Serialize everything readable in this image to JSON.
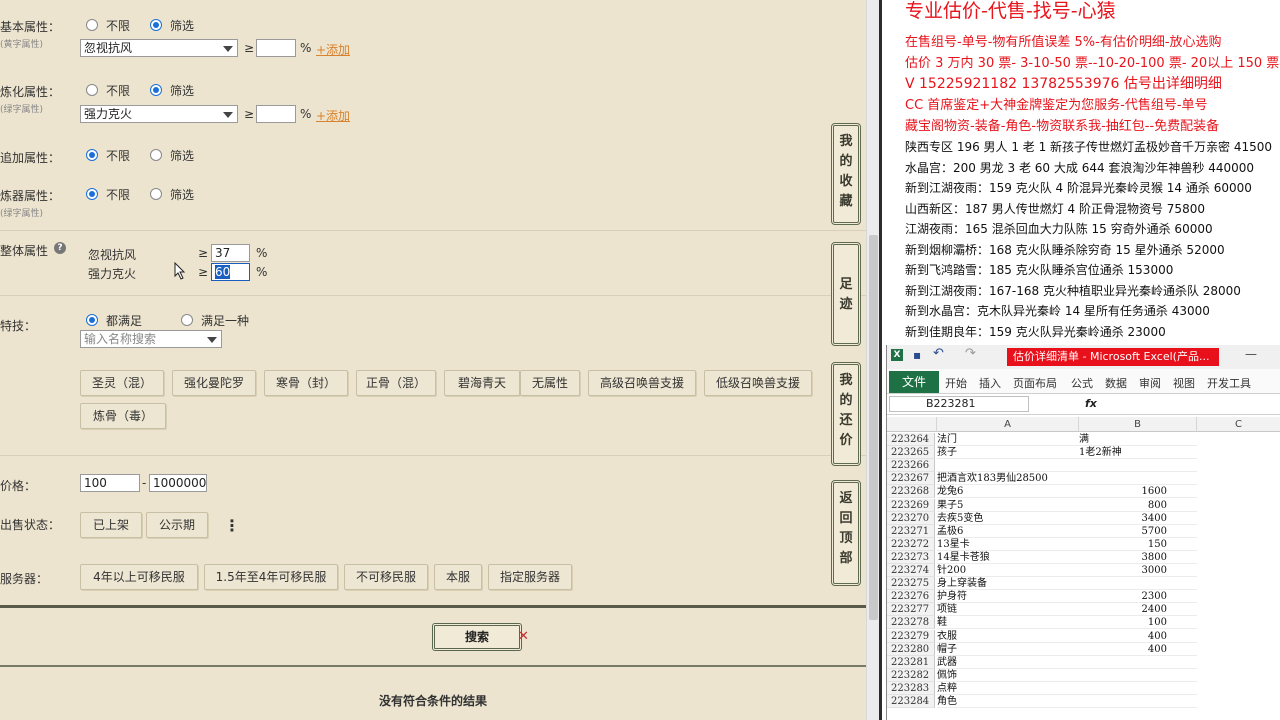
{
  "filters": {
    "basic": {
      "label": "基本属性：",
      "sub": "(黄字属性)",
      "opt1": "不限",
      "opt2": "筛选",
      "select": "忽视抗风",
      "ge": "≥",
      "pct": "%",
      "add": "+添加"
    },
    "refine": {
      "label": "炼化属性：",
      "sub": "(绿字属性)",
      "opt1": "不限",
      "opt2": "筛选",
      "select": "强力克火",
      "ge": "≥",
      "pct": "%",
      "add": "+添加"
    },
    "append": {
      "label": "追加属性：",
      "opt1": "不限",
      "opt2": "筛选"
    },
    "refiner": {
      "label": "炼器属性：",
      "sub": "(绿字属性)",
      "opt1": "不限",
      "opt2": "筛选"
    },
    "overall": {
      "label": "整体属性",
      "help": "?",
      "rows": [
        {
          "name": "忽视抗风",
          "ge": "≥",
          "value": "37",
          "pct": "%"
        },
        {
          "name": "强力克火",
          "ge": "≥",
          "value": "60",
          "pct": "%"
        }
      ]
    },
    "skill": {
      "label": "特技：",
      "opt1": "都满足",
      "opt2": "满足一种",
      "placeholder": "输入名称搜索",
      "tags": [
        "圣灵（混）",
        "强化曼陀罗",
        "寒骨（封）",
        "正骨（混）",
        "碧海青天",
        "无属性",
        "高级召唤兽支援",
        "低级召唤兽支援",
        "炼骨（毒）"
      ]
    },
    "price": {
      "label": "价格：",
      "min": "100",
      "dash": "-",
      "max": "1000000"
    },
    "sale": {
      "label": "出售状态：",
      "buttons": [
        "已上架",
        "公示期"
      ],
      "more": "⋮"
    },
    "server": {
      "label": "服务器：",
      "buttons": [
        "4年以上可移民服",
        "1.5年至4年可移民服",
        "不可移民服",
        "本服",
        "指定服务器"
      ]
    }
  },
  "side_buttons": [
    {
      "text": "我的收藏"
    },
    {
      "text": "足迹"
    },
    {
      "text": "我的还价"
    },
    {
      "text": "返回顶部"
    }
  ],
  "search_label": "搜索",
  "result_text": "没有符合条件的结果",
  "ad": {
    "title": "专业估价-代售-找号-心猿",
    "red_lines": [
      "在售组号-单号-物有所值误差 5%-有估价明细-放心选购",
      "估价 3 万内 30 票- 3-10-50 票--10-20-100 票- 20以上 150 票-1 票 1 元",
      "V 15225921182    13782553976   估号出详细明细",
      "CC 首席鉴定+大神金牌鉴定为您服务-代售组号-单号",
      "藏宝阁物资-装备-角色-物资联系我-抽红包--免费配装备"
    ],
    "black_lines": [
      "陕西专区 196 男人 1 老 1 新孩子传世燃灯孟极妙音千万亲密 41500",
      "水晶宫：200 男龙 3 老 60 大成 644 套浪淘沙年神兽秒 440000",
      "新到江湖夜雨：159 克火队 4 阶混异光秦岭灵猴 14 通杀 60000",
      "山西新区：187 男人传世燃灯 4 阶正骨混物资号 75800",
      "江湖夜雨：165 混杀回血大力队陈 15 穷奇外通杀 60000",
      "新到烟柳灞桥：168 克火队睡杀除穷奇 15 星外通杀 52000",
      "新到飞鸿踏雪：185 克火队睡杀宫位通杀 153000",
      "新到江湖夜雨：167-168 克火种植职业异光秦岭通杀队 28000",
      "新到水晶宫：克木队异光秦岭 14 星所有任务通杀 43000",
      "新到佳期良年：159 克火队异光秦岭通杀 23000"
    ]
  },
  "excel": {
    "doc_title": "估价详细清单 - Microsoft Excel(产品...",
    "file_tab": "文件",
    "tabs": [
      "开始",
      "插入",
      "页面布局",
      "公式",
      "数据",
      "审阅",
      "视图",
      "开发工具"
    ],
    "namebox": "B223281",
    "fx": "fx",
    "columns": [
      "A",
      "B",
      "C"
    ],
    "rows": [
      {
        "n": "223264",
        "a": "法门",
        "b": "满",
        "num": false
      },
      {
        "n": "223265",
        "a": "孩子",
        "b": "1老2新神",
        "num": false
      },
      {
        "n": "223266",
        "a": "",
        "b": "",
        "num": false
      },
      {
        "n": "223267",
        "a": "把酒言欢183男仙28500",
        "b": "",
        "num": false
      },
      {
        "n": "223268",
        "a": "龙兔6",
        "b": "1600",
        "num": true
      },
      {
        "n": "223269",
        "a": "果子5",
        "b": "800",
        "num": true
      },
      {
        "n": "223270",
        "a": "去疾5变色",
        "b": "3400",
        "num": true
      },
      {
        "n": "223271",
        "a": "孟极6",
        "b": "5700",
        "num": true
      },
      {
        "n": "223272",
        "a": "13星卡",
        "b": "150",
        "num": true
      },
      {
        "n": "223273",
        "a": "14星卡苍狼",
        "b": "3800",
        "num": true
      },
      {
        "n": "223274",
        "a": "针200",
        "b": "3000",
        "num": true
      },
      {
        "n": "223275",
        "a": "身上穿装备",
        "b": "",
        "num": false
      },
      {
        "n": "223276",
        "a": "护身符",
        "b": "2300",
        "num": true
      },
      {
        "n": "223277",
        "a": "项链",
        "b": "2400",
        "num": true
      },
      {
        "n": "223278",
        "a": "鞋",
        "b": "100",
        "num": true
      },
      {
        "n": "223279",
        "a": "衣服",
        "b": "400",
        "num": true
      },
      {
        "n": "223280",
        "a": "帽子",
        "b": "400",
        "num": true
      },
      {
        "n": "223281",
        "a": "武器",
        "b": "",
        "num": false
      },
      {
        "n": "223282",
        "a": "佩饰",
        "b": "",
        "num": false
      },
      {
        "n": "223283",
        "a": "点粹",
        "b": "",
        "num": false
      },
      {
        "n": "223284",
        "a": "角色",
        "b": "",
        "num": false
      }
    ]
  }
}
